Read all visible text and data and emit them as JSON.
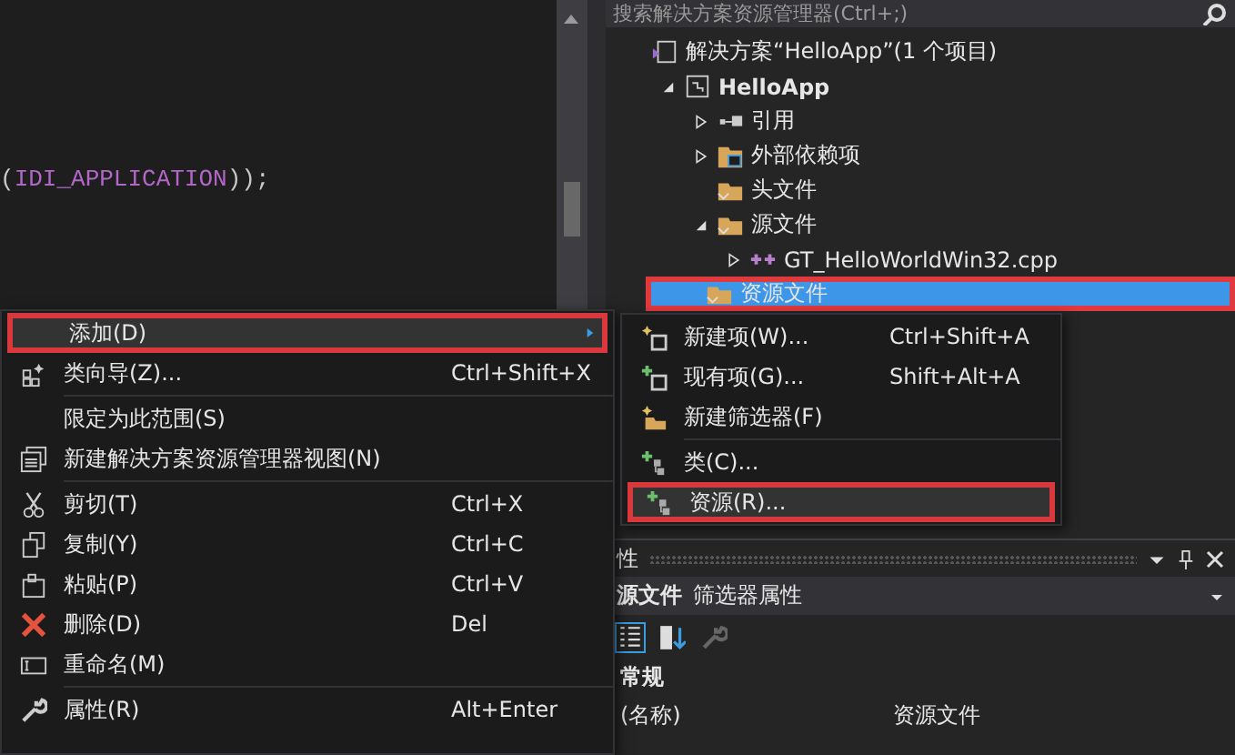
{
  "editor": {
    "code": {
      "open": "(",
      "identifier": "IDI_APPLICATION",
      "close": "));"
    }
  },
  "solution_explorer": {
    "search": {
      "placeholder": "搜索解决方案资源管理器(Ctrl+;)"
    },
    "tree": [
      {
        "label": "解决方案“HelloApp”(1 个项目)",
        "kind": "solution",
        "selected": false,
        "children": [
          {
            "label": "HelloApp",
            "kind": "project",
            "selected": false,
            "expanded": true,
            "children": [
              {
                "label": "引用",
                "kind": "references",
                "selected": false,
                "expanded": false
              },
              {
                "label": "外部依赖项",
                "kind": "external",
                "selected": false,
                "expanded": false
              },
              {
                "label": "头文件",
                "kind": "folder",
                "selected": false
              },
              {
                "label": "源文件",
                "kind": "folder",
                "selected": false,
                "expanded": true,
                "children": [
                  {
                    "label": "GT_HelloWorldWin32.cpp",
                    "kind": "cpp",
                    "selected": false,
                    "expanded": false
                  }
                ]
              },
              {
                "label": "资源文件",
                "kind": "folder",
                "selected": true
              }
            ]
          }
        ]
      }
    ]
  },
  "context_menu": {
    "groups": [
      [
        {
          "label": "添加(D)",
          "kind": "submenu",
          "selected": true
        },
        {
          "label": "类向导(Z)...",
          "kind": "wizard",
          "shortcut": "Ctrl+Shift+X",
          "selected": false
        }
      ],
      [
        {
          "label": "限定为此范围(S)",
          "kind": "plain",
          "selected": false
        },
        {
          "label": "新建解决方案资源管理器视图(N)",
          "kind": "view",
          "selected": false
        }
      ],
      [
        {
          "label": "剪切(T)",
          "kind": "cut",
          "shortcut": "Ctrl+X",
          "selected": false
        },
        {
          "label": "复制(Y)",
          "kind": "copy",
          "shortcut": "Ctrl+C",
          "selected": false
        },
        {
          "label": "粘贴(P)",
          "kind": "paste",
          "shortcut": "Ctrl+V",
          "selected": false
        },
        {
          "label": "删除(D)",
          "kind": "delete",
          "shortcut": "Del",
          "selected": false
        },
        {
          "label": "重命名(M)",
          "kind": "rename",
          "selected": false
        }
      ],
      [
        {
          "label": "属性(R)",
          "kind": "properties",
          "shortcut": "Alt+Enter",
          "selected": false
        }
      ]
    ]
  },
  "submenu": {
    "groups": [
      [
        {
          "label": "新建项(W)...",
          "kind": "newitem",
          "shortcut": "Ctrl+Shift+A",
          "selected": false
        },
        {
          "label": "现有项(G)...",
          "kind": "existing",
          "shortcut": "Shift+Alt+A",
          "selected": false
        },
        {
          "label": "新建筛选器(F)",
          "kind": "filter",
          "selected": false
        }
      ],
      [
        {
          "label": "类(C)...",
          "kind": "addclass",
          "selected": false
        },
        {
          "label": "资源(R)...",
          "kind": "addclass",
          "selected": true
        }
      ]
    ]
  },
  "properties": {
    "title": "性",
    "object": {
      "name": "源文件",
      "type": "筛选器属性"
    },
    "category": "常规",
    "rows": [
      {
        "name": "(名称)",
        "value": "资源文件"
      }
    ]
  }
}
